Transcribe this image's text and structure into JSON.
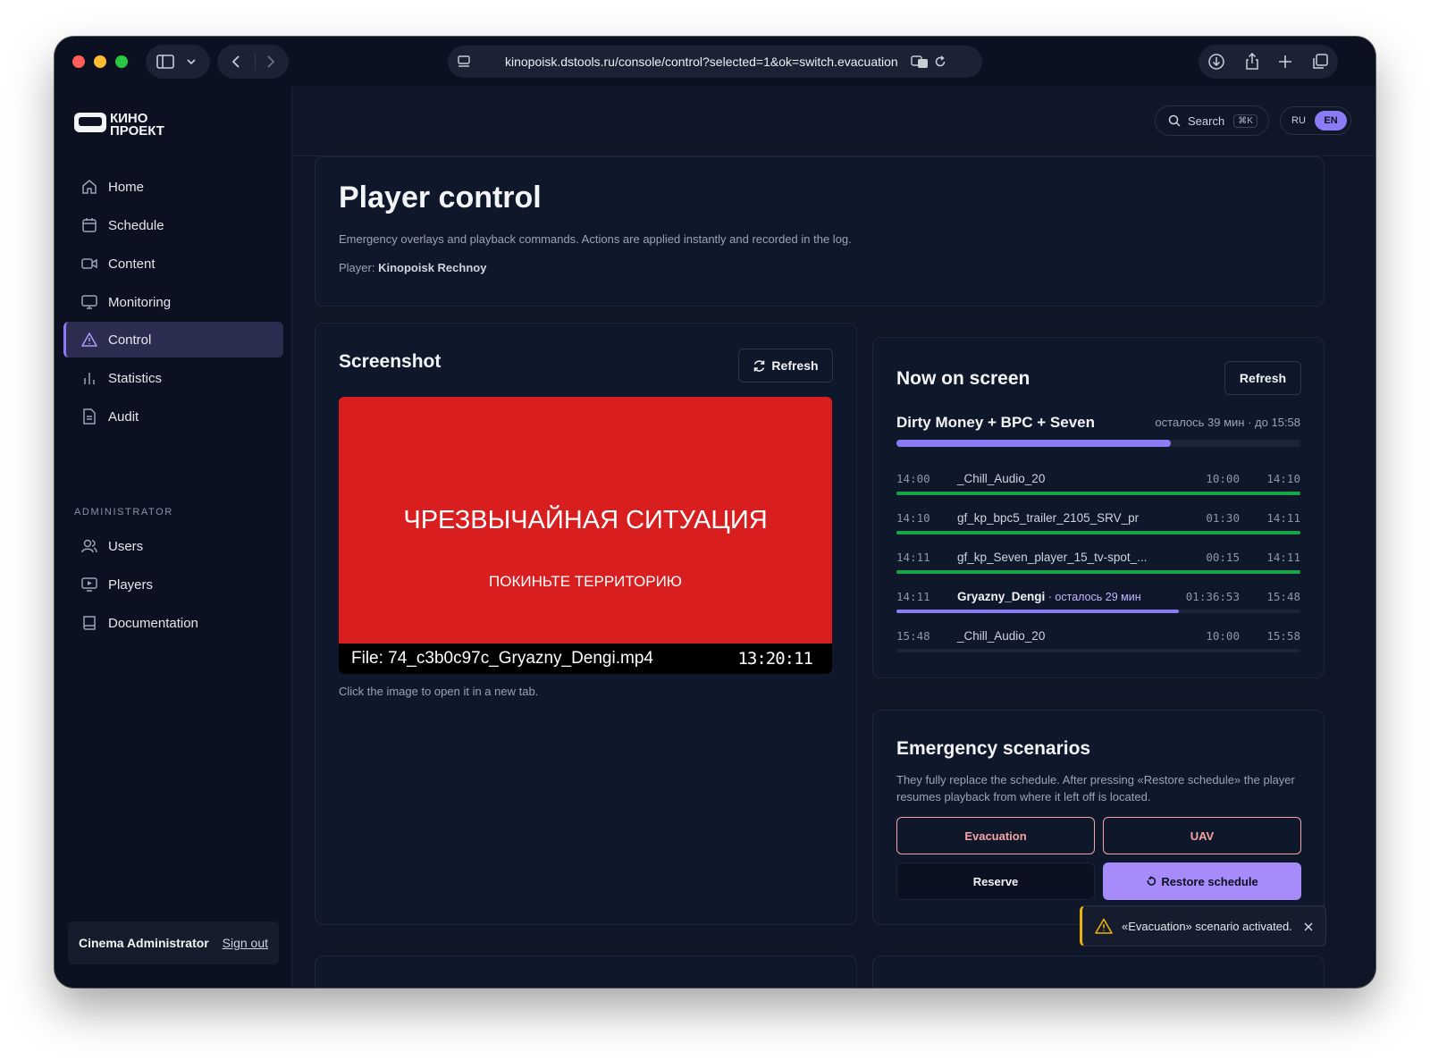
{
  "browser": {
    "url": "kinopoisk.dstools.ru/console/control?selected=1&ok=switch.evacuation"
  },
  "brand": {
    "line1": "КИНО",
    "line2": "ПРОЕКТ"
  },
  "sidebar": {
    "items": [
      {
        "label": "Home",
        "icon": "home-icon"
      },
      {
        "label": "Schedule",
        "icon": "calendar-icon"
      },
      {
        "label": "Content",
        "icon": "video-icon"
      },
      {
        "label": "Monitoring",
        "icon": "monitor-icon"
      },
      {
        "label": "Control",
        "icon": "warning-icon",
        "active": true
      },
      {
        "label": "Statistics",
        "icon": "bar-chart-icon"
      },
      {
        "label": "Audit",
        "icon": "document-icon"
      }
    ],
    "admin_label": "ADMINISTRATOR",
    "admin_items": [
      {
        "label": "Users",
        "icon": "users-icon"
      },
      {
        "label": "Players",
        "icon": "player-icon"
      },
      {
        "label": "Documentation",
        "icon": "book-icon"
      }
    ],
    "user_name": "Cinema Administrator",
    "sign_out": "Sign out"
  },
  "topbar": {
    "search_label": "Search",
    "search_shortcut": "⌘K",
    "lang_ru": "RU",
    "lang_en": "EN"
  },
  "header": {
    "title": "Player control",
    "description": "Emergency overlays and playback commands. Actions are applied instantly and recorded in the log.",
    "player_label": "Player:",
    "player_name": "Kinopoisk Rechnoy"
  },
  "screenshot": {
    "title": "Screenshot",
    "refresh": "Refresh",
    "overlay_title": "ЧРЕЗВЫЧАЙНАЯ СИТУАЦИЯ",
    "overlay_subtitle": "ПОКИНЬТЕ ТЕРРИТОРИЮ",
    "file": "File: 74_c3b0c97c_Gryazny_Dengi.mp4",
    "time": "13:20:11",
    "hint": "Click the image to open it in a new tab."
  },
  "now_on_screen": {
    "title": "Now on screen",
    "refresh": "Refresh",
    "program": "Dirty Money + BPC + Seven",
    "remaining": "осталось 39 мин · до 15:58",
    "program_progress": 0.68,
    "rows": [
      {
        "start": "14:00",
        "name": "_Chill_Audio_20",
        "extra": "",
        "duration": "10:00",
        "end": "14:10",
        "progress": 1.0,
        "state": "done"
      },
      {
        "start": "14:10",
        "name": "gf_kp_bpc5_trailer_2105_SRV_pr",
        "extra": "",
        "duration": "01:30",
        "end": "14:11",
        "progress": 1.0,
        "state": "done"
      },
      {
        "start": "14:11",
        "name": "gf_kp_Seven_player_15_tv-spot_...",
        "extra": "",
        "duration": "00:15",
        "end": "14:11",
        "progress": 1.0,
        "state": "done"
      },
      {
        "start": "14:11",
        "name": "Gryazny_Dengi",
        "extra": " · осталось 29 мин",
        "duration": "01:36:53",
        "end": "15:48",
        "progress": 0.7,
        "state": "current"
      },
      {
        "start": "15:48",
        "name": "_Chill_Audio_20",
        "extra": "",
        "duration": "10:00",
        "end": "15:58",
        "progress": 0.0,
        "state": "upcoming"
      }
    ]
  },
  "emergency": {
    "title": "Emergency scenarios",
    "description": "They fully replace the schedule. After pressing «Restore schedule» the player resumes playback from where it left off is located.",
    "evacuation": "Evacuation",
    "uav": "UAV",
    "reserve": "Reserve",
    "restore": "Restore schedule"
  },
  "toast": {
    "message": "«Evacuation» scenario activated."
  },
  "colors": {
    "accent": "#8b7cf6",
    "success": "#16a34a",
    "danger": "#d81e1e",
    "warning": "#eab308"
  }
}
